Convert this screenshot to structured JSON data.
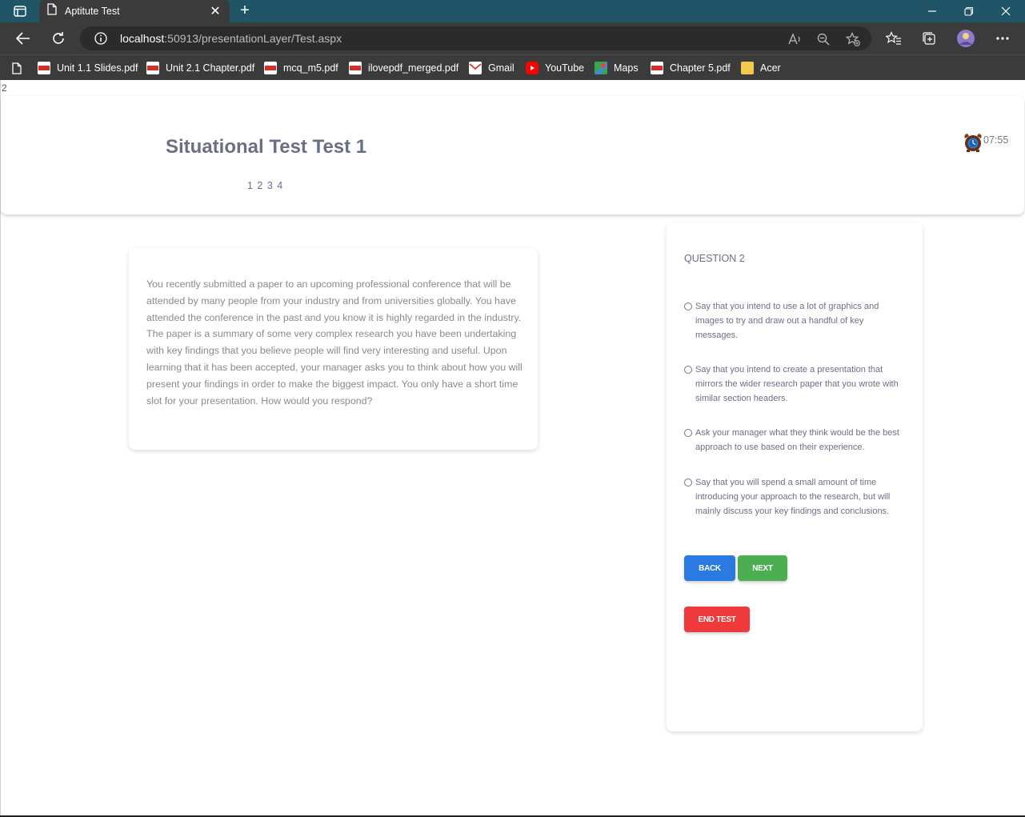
{
  "browser": {
    "tab_title": "Aptitute Test",
    "url_host": "localhost",
    "url_rest": ":50913/presentationLayer/Test.aspx"
  },
  "bookmarks": [
    {
      "label": "Unit 1.1 Slides.pdf",
      "icon": "pdf-icon"
    },
    {
      "label": "Unit 2.1 Chapter.pdf",
      "icon": "pdf-icon"
    },
    {
      "label": "mcq_m5.pdf",
      "icon": "pdf-icon"
    },
    {
      "label": "ilovepdf_merged.pdf",
      "icon": "pdf-icon"
    },
    {
      "label": "Gmail",
      "icon": "gmail-icon"
    },
    {
      "label": "YouTube",
      "icon": "youtube-icon"
    },
    {
      "label": "Maps",
      "icon": "maps-icon"
    },
    {
      "label": "Chapter 5.pdf",
      "icon": "pdf-icon"
    },
    {
      "label": "Acer",
      "icon": "folder-icon"
    }
  ],
  "page": {
    "corner_number": "2",
    "test_title": "Situational Test Test 1",
    "pager": "1 2 3 4",
    "timer": "07:55",
    "scenario": "You recently submitted a paper to an upcoming professional conference that will be attended by many people from your industry and from universities globally. You have attended the conference in the past and you know it is highly regarded in the industry. The paper is a summary of some very complex research you have been undertaking with key findings that you believe people will find very interesting and useful. Upon learning that it has been accepted, your manager asks you to think about how you will present your findings in order to make the biggest impact. You only have a short time slot for your presentation. How would you respond?",
    "question_label": "QUESTION 2",
    "options": [
      "Say that you intend to use a lot of graphics and images to try and draw out a handful of key messages.",
      "Say that you intend to create a presentation that mirrors the wider research paper that you wrote with similar section headers.",
      "Ask your manager what they think would be the best approach to use based on their experience.",
      "Say that you will spend a small amount of time introducing your approach to the research, but will mainly discuss your key findings and conclusions."
    ],
    "back_label": "BACK",
    "next_label": "NEXT",
    "end_label": "END TEST"
  },
  "colors": {
    "back": "#2a7ae2",
    "next": "#4cae50",
    "end": "#ee3a3a",
    "title": "#6a6f86"
  }
}
